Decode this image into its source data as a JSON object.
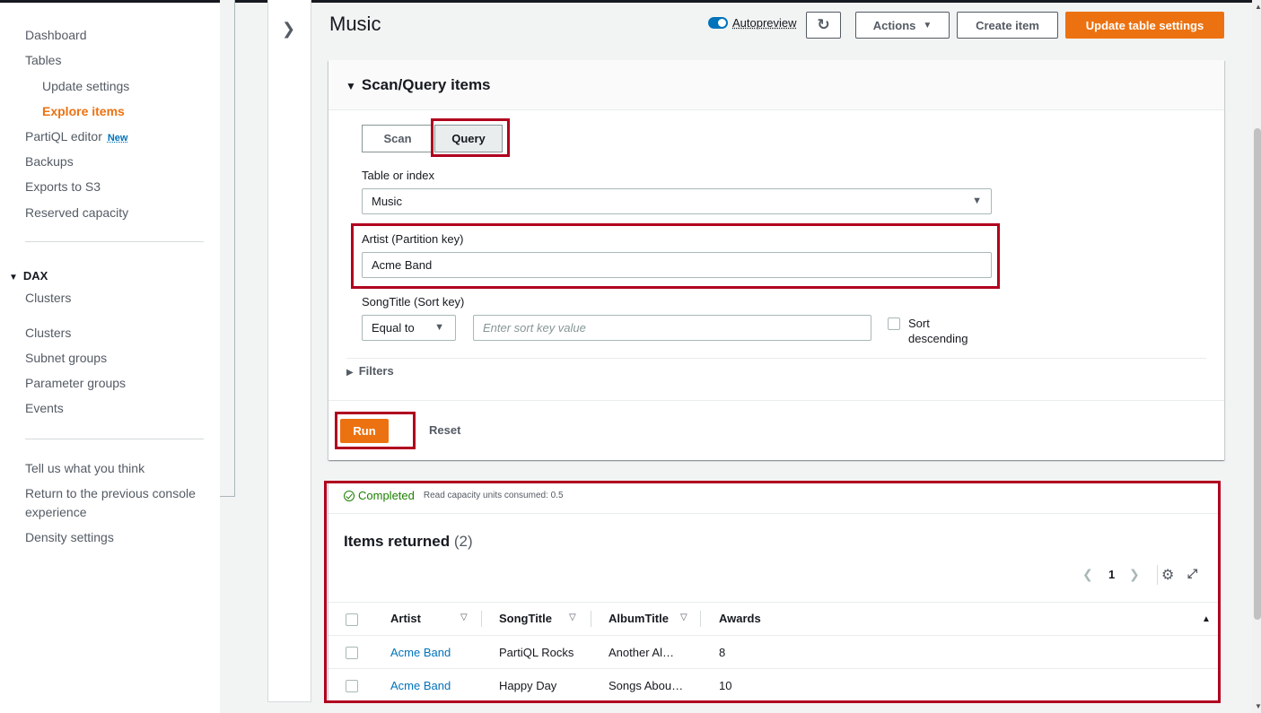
{
  "sidebar": {
    "items": [
      {
        "label": "Dashboard"
      },
      {
        "label": "Tables"
      },
      {
        "label": "Update settings"
      },
      {
        "label": "Explore items"
      },
      {
        "label": "PartiQL editor",
        "badge": "New"
      },
      {
        "label": "Backups"
      },
      {
        "label": "Exports to S3"
      },
      {
        "label": "Reserved capacity"
      }
    ],
    "dax_section": "DAX",
    "dax_items": [
      {
        "label": "Clusters"
      },
      {
        "label": "Clusters"
      },
      {
        "label": "Subnet groups"
      },
      {
        "label": "Parameter groups"
      },
      {
        "label": "Events"
      }
    ],
    "footer_items": [
      {
        "label": "Tell us what you think"
      },
      {
        "label": "Return to the previous console"
      },
      {
        "label": "experience"
      },
      {
        "label": "Density settings"
      }
    ]
  },
  "header": {
    "title": "Music",
    "autopreview_label": "Autopreview",
    "actions_label": "Actions",
    "create_item_label": "Create item",
    "update_settings_label": "Update table settings"
  },
  "query_panel": {
    "title": "Scan/Query items",
    "scan_label": "Scan",
    "query_label": "Query",
    "table_or_index_label": "Table or index",
    "table_or_index_value": "Music",
    "partition_key_label": "Artist (Partition key)",
    "partition_key_value": "Acme Band",
    "sort_key_label": "SongTitle (Sort key)",
    "sort_operator": "Equal to",
    "sort_key_placeholder": "Enter sort key value",
    "sort_descending_line1": "Sort",
    "sort_descending_line2": "descending",
    "filters_label": "Filters",
    "run_label": "Run",
    "reset_label": "Reset"
  },
  "results": {
    "status": "Completed",
    "rcu_text": "Read capacity units consumed: 0.5",
    "items_title": "Items returned",
    "items_count": "(2)",
    "page": "1",
    "columns": [
      "Artist",
      "SongTitle",
      "AlbumTitle",
      "Awards"
    ],
    "rows": [
      {
        "artist": "Acme Band",
        "song": "PartiQL Rocks",
        "album": "Another Al…",
        "awards": "8"
      },
      {
        "artist": "Acme Band",
        "song": "Happy Day",
        "album": "Songs Abou…",
        "awards": "10"
      }
    ]
  },
  "colors": {
    "accent": "#ec7211",
    "link": "#0073bb",
    "highlight": "#b0001e",
    "success": "#1d8102"
  },
  "icons": [
    "chevron-right-icon",
    "refresh-icon",
    "caret-down-icon",
    "check-circle-icon",
    "gear-icon",
    "expand-icon"
  ]
}
